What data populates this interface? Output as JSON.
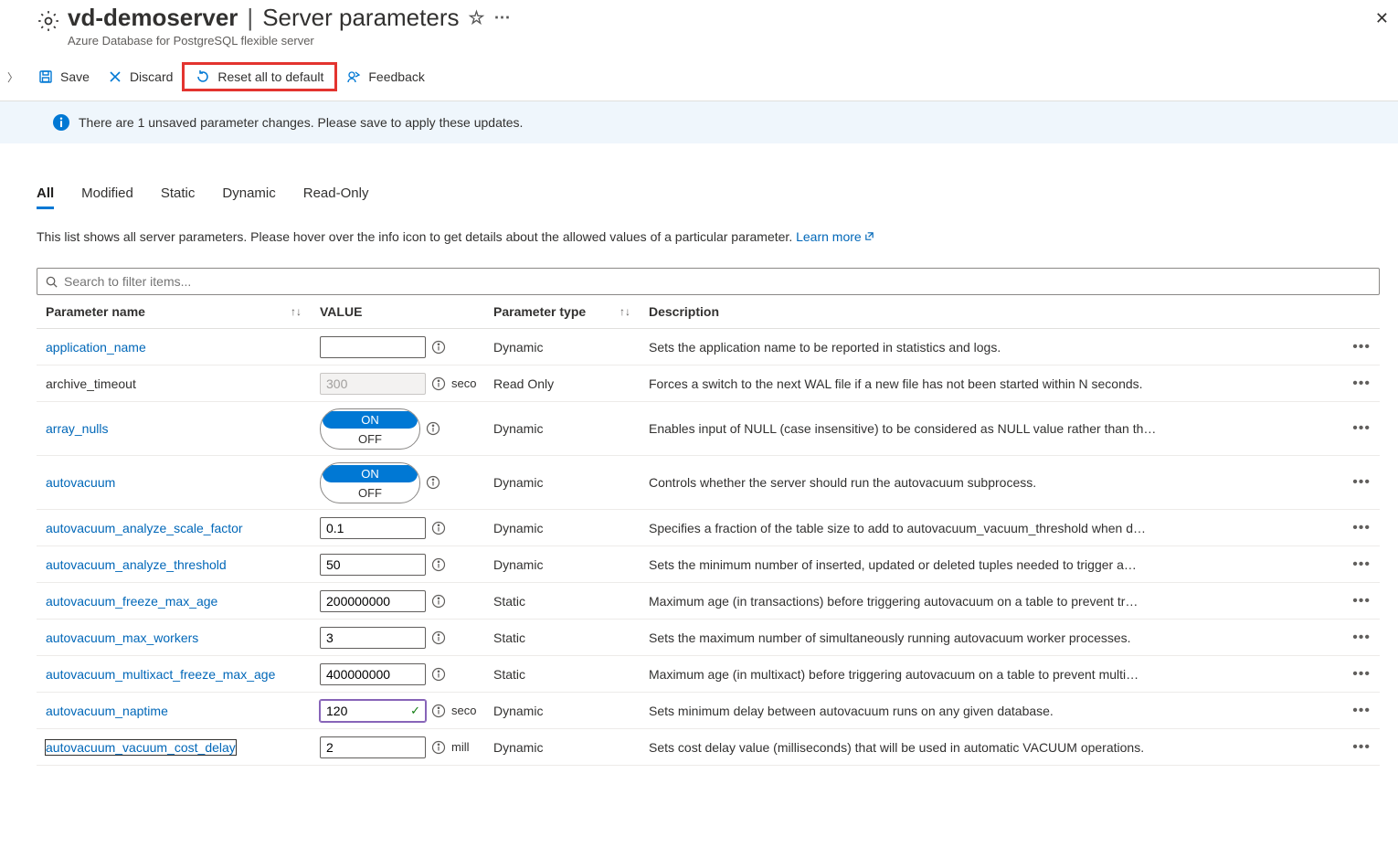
{
  "header": {
    "resource_name": "vd-demoserver",
    "page_title": "Server parameters",
    "resource_type": "Azure Database for PostgreSQL flexible server"
  },
  "toolbar": {
    "save": "Save",
    "discard": "Discard",
    "reset": "Reset all to default",
    "feedback": "Feedback"
  },
  "infobar": {
    "message": "There are 1 unsaved parameter changes.  Please save to apply these updates."
  },
  "tabs": [
    "All",
    "Modified",
    "Static",
    "Dynamic",
    "Read-Only"
  ],
  "description": {
    "text": "This list shows all server parameters. Please hover over the info icon to get details about the allowed values of a particular parameter. ",
    "learn_more": "Learn more"
  },
  "search": {
    "placeholder": "Search to filter items..."
  },
  "columns": {
    "name": "Parameter name",
    "value": "VALUE",
    "type": "Parameter type",
    "desc": "Description"
  },
  "rows": [
    {
      "name": "application_name",
      "link": true,
      "value_kind": "text",
      "value": "",
      "type": "Dynamic",
      "unit": "",
      "desc": "Sets the application name to be reported in statistics and logs."
    },
    {
      "name": "archive_timeout",
      "link": false,
      "value_kind": "readonly",
      "value": "300",
      "type": "Read Only",
      "unit": "seco",
      "desc": "Forces a switch to the next WAL file if a new file has not been started within N seconds."
    },
    {
      "name": "array_nulls",
      "link": true,
      "value_kind": "toggle",
      "value": "ON",
      "type": "Dynamic",
      "unit": "",
      "desc": "Enables input of NULL (case insensitive) to be considered as NULL value rather than th…"
    },
    {
      "name": "autovacuum",
      "link": true,
      "value_kind": "toggle",
      "value": "ON",
      "type": "Dynamic",
      "unit": "",
      "desc": "Controls whether the server should run the autovacuum subprocess."
    },
    {
      "name": "autovacuum_analyze_scale_factor",
      "link": true,
      "value_kind": "text",
      "value": "0.1",
      "type": "Dynamic",
      "unit": "",
      "desc": "Specifies a fraction of the table size to add to autovacuum_vacuum_threshold when d…"
    },
    {
      "name": "autovacuum_analyze_threshold",
      "link": true,
      "value_kind": "text",
      "value": "50",
      "type": "Dynamic",
      "unit": "",
      "desc": "Sets the minimum number of inserted, updated or deleted tuples needed to trigger a…"
    },
    {
      "name": "autovacuum_freeze_max_age",
      "link": true,
      "value_kind": "text",
      "value": "200000000",
      "type": "Static",
      "unit": "",
      "desc": "Maximum age (in transactions) before triggering autovacuum on a table to prevent tr…"
    },
    {
      "name": "autovacuum_max_workers",
      "link": true,
      "value_kind": "text",
      "value": "3",
      "type": "Static",
      "unit": "",
      "desc": "Sets the maximum number of simultaneously running autovacuum worker processes."
    },
    {
      "name": "autovacuum_multixact_freeze_max_age",
      "link": true,
      "value_kind": "text",
      "value": "400000000",
      "type": "Static",
      "unit": "",
      "desc": "Maximum age (in multixact) before triggering autovacuum on a table to prevent multi…"
    },
    {
      "name": "autovacuum_naptime",
      "link": true,
      "value_kind": "changed",
      "value": "120",
      "type": "Dynamic",
      "unit": "seco",
      "desc": "Sets minimum delay between autovacuum runs on any given database."
    },
    {
      "name": "autovacuum_vacuum_cost_delay",
      "link": true,
      "value_kind": "text",
      "value": "2",
      "type": "Dynamic",
      "unit": "mill",
      "desc": "Sets cost delay value (milliseconds) that will be used in automatic VACUUM operations.",
      "focused": true
    }
  ]
}
